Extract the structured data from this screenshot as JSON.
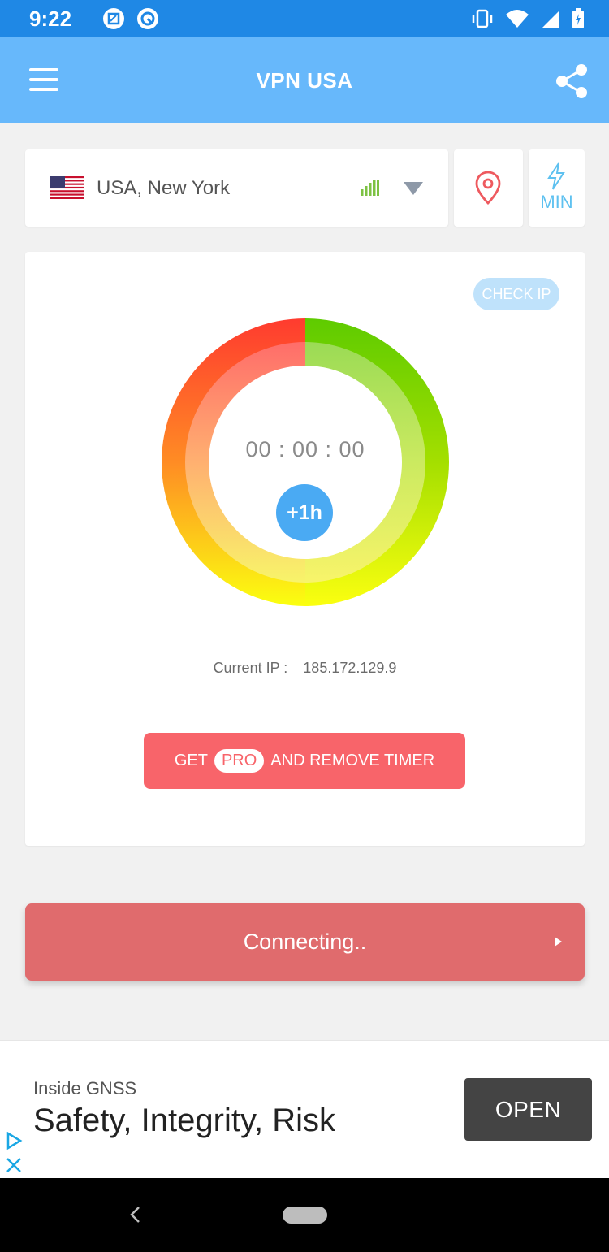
{
  "status_bar": {
    "time": "9:22"
  },
  "app_bar": {
    "title": "VPN USA"
  },
  "location": {
    "name": "USA, New York"
  },
  "min_button": {
    "label": "MIN"
  },
  "main": {
    "check_ip_label": "CHECK IP",
    "timer": "00 : 00 : 00",
    "add_hour_label": "+1h",
    "current_ip_label": "Current IP :",
    "current_ip_value": "185.172.129.9",
    "pro_button": {
      "prefix": "GET",
      "pill": "PRO",
      "suffix": "AND REMOVE TIMER"
    }
  },
  "connect_bar": {
    "label": "Connecting.."
  },
  "ad": {
    "source": "Inside GNSS",
    "headline": "Safety, Integrity, Risk",
    "open_label": "OPEN"
  },
  "colors": {
    "status_bar": "#1f88e5",
    "app_bar": "#67b8fb",
    "accent_red": "#f8646a",
    "connect_bar": "#e06b6d",
    "ring_red": "#ff3b30",
    "ring_green": "#5ecb00",
    "ring_yellow": "#fbff10"
  }
}
